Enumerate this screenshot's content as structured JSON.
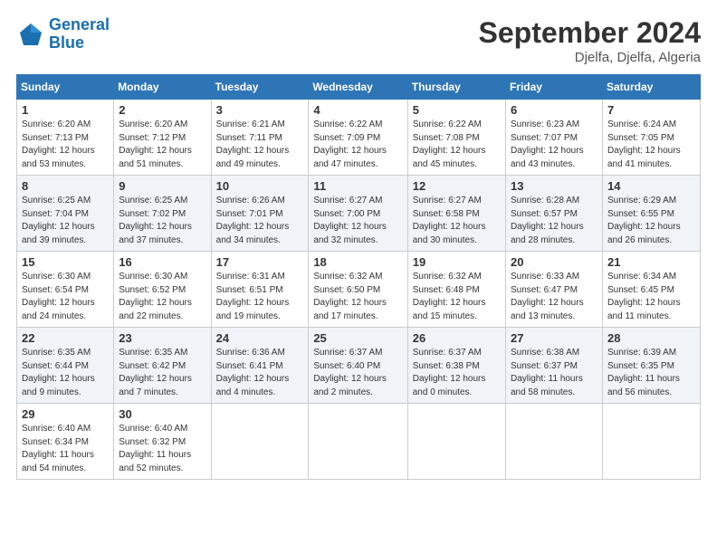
{
  "header": {
    "logo_line1": "General",
    "logo_line2": "Blue",
    "month": "September 2024",
    "location": "Djelfa, Djelfa, Algeria"
  },
  "days_of_week": [
    "Sunday",
    "Monday",
    "Tuesday",
    "Wednesday",
    "Thursday",
    "Friday",
    "Saturday"
  ],
  "weeks": [
    [
      {
        "day": "1",
        "sunrise": "6:20 AM",
        "sunset": "7:13 PM",
        "daylight": "12 hours and 53 minutes."
      },
      {
        "day": "2",
        "sunrise": "6:20 AM",
        "sunset": "7:12 PM",
        "daylight": "12 hours and 51 minutes."
      },
      {
        "day": "3",
        "sunrise": "6:21 AM",
        "sunset": "7:11 PM",
        "daylight": "12 hours and 49 minutes."
      },
      {
        "day": "4",
        "sunrise": "6:22 AM",
        "sunset": "7:09 PM",
        "daylight": "12 hours and 47 minutes."
      },
      {
        "day": "5",
        "sunrise": "6:22 AM",
        "sunset": "7:08 PM",
        "daylight": "12 hours and 45 minutes."
      },
      {
        "day": "6",
        "sunrise": "6:23 AM",
        "sunset": "7:07 PM",
        "daylight": "12 hours and 43 minutes."
      },
      {
        "day": "7",
        "sunrise": "6:24 AM",
        "sunset": "7:05 PM",
        "daylight": "12 hours and 41 minutes."
      }
    ],
    [
      {
        "day": "8",
        "sunrise": "6:25 AM",
        "sunset": "7:04 PM",
        "daylight": "12 hours and 39 minutes."
      },
      {
        "day": "9",
        "sunrise": "6:25 AM",
        "sunset": "7:02 PM",
        "daylight": "12 hours and 37 minutes."
      },
      {
        "day": "10",
        "sunrise": "6:26 AM",
        "sunset": "7:01 PM",
        "daylight": "12 hours and 34 minutes."
      },
      {
        "day": "11",
        "sunrise": "6:27 AM",
        "sunset": "7:00 PM",
        "daylight": "12 hours and 32 minutes."
      },
      {
        "day": "12",
        "sunrise": "6:27 AM",
        "sunset": "6:58 PM",
        "daylight": "12 hours and 30 minutes."
      },
      {
        "day": "13",
        "sunrise": "6:28 AM",
        "sunset": "6:57 PM",
        "daylight": "12 hours and 28 minutes."
      },
      {
        "day": "14",
        "sunrise": "6:29 AM",
        "sunset": "6:55 PM",
        "daylight": "12 hours and 26 minutes."
      }
    ],
    [
      {
        "day": "15",
        "sunrise": "6:30 AM",
        "sunset": "6:54 PM",
        "daylight": "12 hours and 24 minutes."
      },
      {
        "day": "16",
        "sunrise": "6:30 AM",
        "sunset": "6:52 PM",
        "daylight": "12 hours and 22 minutes."
      },
      {
        "day": "17",
        "sunrise": "6:31 AM",
        "sunset": "6:51 PM",
        "daylight": "12 hours and 19 minutes."
      },
      {
        "day": "18",
        "sunrise": "6:32 AM",
        "sunset": "6:50 PM",
        "daylight": "12 hours and 17 minutes."
      },
      {
        "day": "19",
        "sunrise": "6:32 AM",
        "sunset": "6:48 PM",
        "daylight": "12 hours and 15 minutes."
      },
      {
        "day": "20",
        "sunrise": "6:33 AM",
        "sunset": "6:47 PM",
        "daylight": "12 hours and 13 minutes."
      },
      {
        "day": "21",
        "sunrise": "6:34 AM",
        "sunset": "6:45 PM",
        "daylight": "12 hours and 11 minutes."
      }
    ],
    [
      {
        "day": "22",
        "sunrise": "6:35 AM",
        "sunset": "6:44 PM",
        "daylight": "12 hours and 9 minutes."
      },
      {
        "day": "23",
        "sunrise": "6:35 AM",
        "sunset": "6:42 PM",
        "daylight": "12 hours and 7 minutes."
      },
      {
        "day": "24",
        "sunrise": "6:36 AM",
        "sunset": "6:41 PM",
        "daylight": "12 hours and 4 minutes."
      },
      {
        "day": "25",
        "sunrise": "6:37 AM",
        "sunset": "6:40 PM",
        "daylight": "12 hours and 2 minutes."
      },
      {
        "day": "26",
        "sunrise": "6:37 AM",
        "sunset": "6:38 PM",
        "daylight": "12 hours and 0 minutes."
      },
      {
        "day": "27",
        "sunrise": "6:38 AM",
        "sunset": "6:37 PM",
        "daylight": "11 hours and 58 minutes."
      },
      {
        "day": "28",
        "sunrise": "6:39 AM",
        "sunset": "6:35 PM",
        "daylight": "11 hours and 56 minutes."
      }
    ],
    [
      {
        "day": "29",
        "sunrise": "6:40 AM",
        "sunset": "6:34 PM",
        "daylight": "11 hours and 54 minutes."
      },
      {
        "day": "30",
        "sunrise": "6:40 AM",
        "sunset": "6:32 PM",
        "daylight": "11 hours and 52 minutes."
      },
      null,
      null,
      null,
      null,
      null
    ]
  ]
}
